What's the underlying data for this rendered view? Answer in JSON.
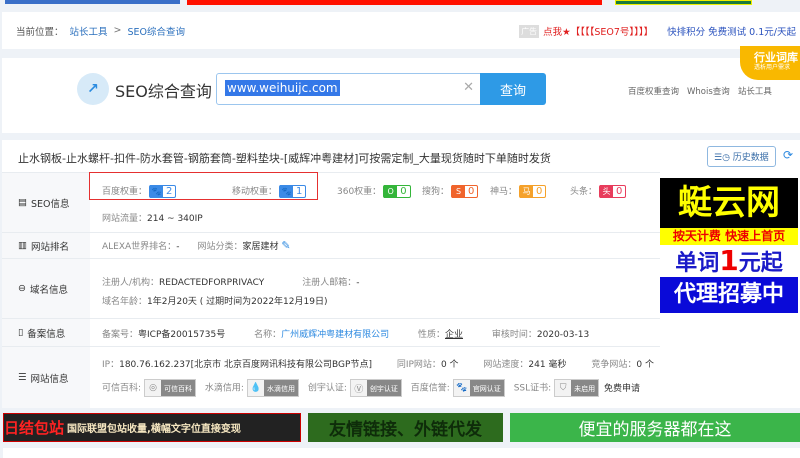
{
  "breadcrumb": {
    "prefix": "当前位置：",
    "items": [
      "站长工具",
      "SEO综合查询"
    ],
    "sep": ">"
  },
  "top_right": {
    "ad_tag": "广告",
    "promo": "点我★【【【【SEO7号】】】】",
    "fast": "快排积分 免费测试 0.1元/天起"
  },
  "search": {
    "logo_text": "SEO综合查询",
    "value": "www.weihuijc.com",
    "button": "查询",
    "links": [
      "百度权重查询",
      "Whois查询",
      "站长工具"
    ],
    "badge_title": "行业词库",
    "badge_sub": "透析用户需求"
  },
  "site_title": "止水钢板-止水螺杆-扣件-防水套管-钢筋套筒-塑料垫块-[威辉冲粤建材]可按需定制_大量现货随时下单随时发货",
  "history_button": "历史数据",
  "seo": {
    "label": "SEO信息",
    "weights": [
      {
        "name": "百度权重：",
        "value": "2",
        "color": "#3b8ae6",
        "icon": "🐾"
      },
      {
        "name": "移动权重：",
        "value": "1",
        "color": "#3b8ae6",
        "icon": "🐾"
      },
      {
        "name": "360权重：",
        "value": "0",
        "color": "#34b53a",
        "icon": "O"
      },
      {
        "name": "搜狗：",
        "value": "0",
        "color": "#f0642c",
        "icon": "S"
      },
      {
        "name": "神马：",
        "value": "0",
        "color": "#f5a12a",
        "icon": "马"
      },
      {
        "name": "头条：",
        "value": "0",
        "color": "#e83c5c",
        "icon": "头"
      }
    ],
    "traffic_label": "网站流量：",
    "traffic": "214 ~ 340IP"
  },
  "rank": {
    "label": "网站排名",
    "alexa_label": "ALEXA世界排名：",
    "alexa": "-",
    "cat_label": "网站分类：",
    "cat": "家居建材"
  },
  "domain": {
    "label": "域名信息",
    "reg_label": "注册人/机构：",
    "reg": "REDACTEDFORPRIVACY",
    "email_label": "注册人邮箱：",
    "email": "-",
    "age_label": "域名年龄：",
    "age": "1年2月20天 ( 过期时间为2022年12月19日)"
  },
  "icp": {
    "label": "备案信息",
    "no_label": "备案号：",
    "no": "粤ICP备20015735号",
    "name_label": "名称：",
    "name": "广州威辉冲粤建材有限公司",
    "type_label": "性质：",
    "type": "企业",
    "date_label": "审核时间：",
    "date": "2020-03-13"
  },
  "site": {
    "label": "网站信息",
    "ip_label": "IP：",
    "ip": "180.76.162.237[北京市 北京百度网讯科技有限公司BGP节点]",
    "same_ip_label": "同IP网站：",
    "same_ip": "0 个",
    "speed_label": "网站速度：",
    "speed": "241 毫秒",
    "compete_label": "竞争网站：",
    "compete": "0 个",
    "seals": [
      {
        "label": "可信百科:",
        "badge": "可信百科"
      },
      {
        "label": "水滴信用:",
        "badge": "水滴信用"
      },
      {
        "label": "创宇认证:",
        "badge": "创宇认证"
      },
      {
        "label": "百度信誉:",
        "badge": "官网认证"
      },
      {
        "label": "SSL证书:",
        "badge": "未启用"
      }
    ],
    "ssl_apply": "免费申请"
  },
  "right_ad": {
    "l1": "蜓云网",
    "l2": "按天计费 快速上首页",
    "l3a": "单词",
    "l3b": "1",
    "l3c": "元起",
    "l4": "代理招募中"
  },
  "bottom_ads": {
    "a1a": "日结包站",
    "a1b": "国际联盟包站收量,横幅文字位直接变现",
    "a2": "友情链接、外链代发",
    "a3": "便宜的服务器都在这"
  }
}
